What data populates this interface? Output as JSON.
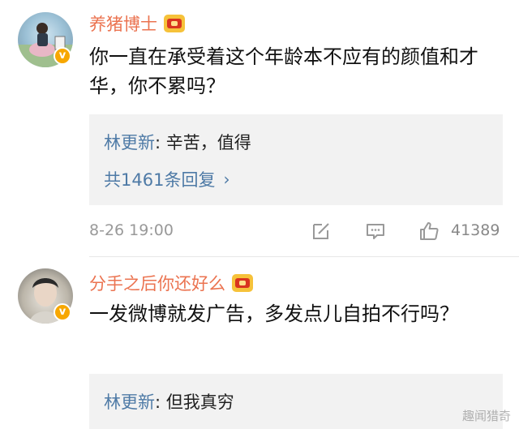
{
  "comments": [
    {
      "username": "养猪博士",
      "text": "你一直在承受着这个年龄本不应有的颜值和才华，你不累吗？",
      "reply": {
        "author": "林更新",
        "sep": ": ",
        "text": "辛苦，值得"
      },
      "reply_count": "共1461条回复",
      "timestamp": "8-26 19:00",
      "likes": "41389",
      "verified_mark": "v"
    },
    {
      "username": "分手之后你还好么",
      "text": "一发微博就发广告，多发点儿自拍不行吗？",
      "reply": {
        "author": "林更新",
        "sep": ": ",
        "text": "但我真穷"
      },
      "verified_mark": "v"
    }
  ],
  "watermark": "趣闻猎奇",
  "icons": {
    "edit": "edit-icon",
    "comment": "comment-icon",
    "like": "thumbs-up-icon",
    "reply_more": "chevron-right-icon",
    "badge": "crown-icon"
  },
  "colors": {
    "username": "#eb7350",
    "link": "#4e7aa6",
    "verified": "#f7a700",
    "reply_bg": "#f2f2f2"
  }
}
